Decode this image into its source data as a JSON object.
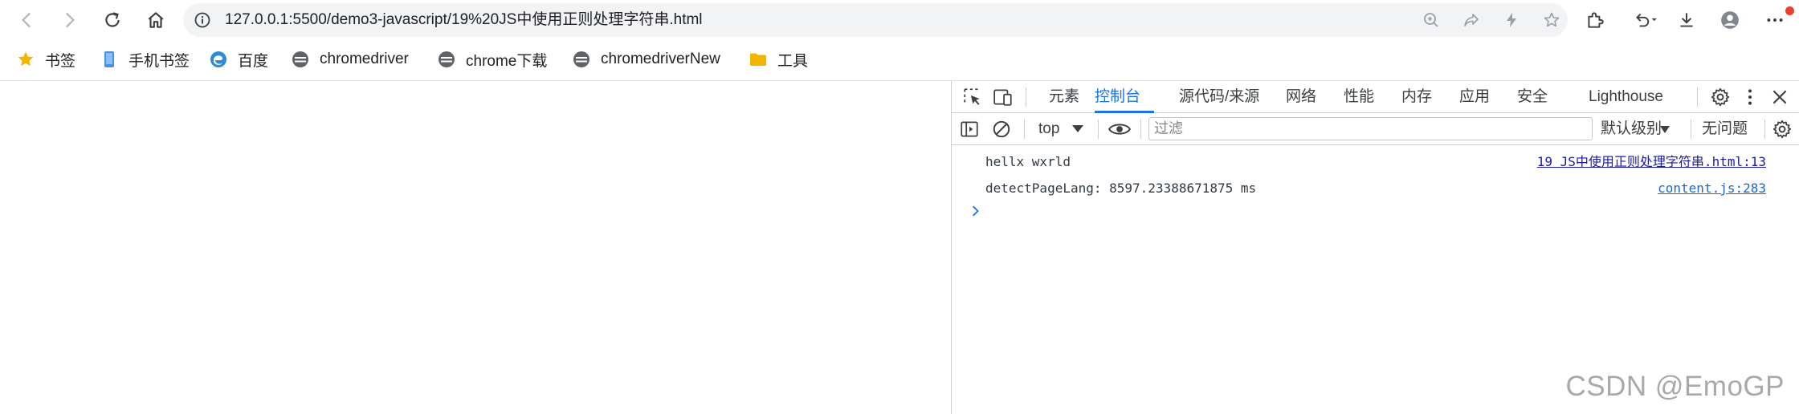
{
  "toolbar": {
    "back_icon": "back-arrow-icon",
    "forward_icon": "forward-arrow-icon",
    "reload_icon": "reload-icon",
    "home_icon": "home-icon",
    "url": "127.0.0.1:5500/demo3-javascript/19%20JS中使用正则处理字符串.html",
    "omnibox_icons": [
      "zoom-icon",
      "share-icon",
      "lightning-icon",
      "star-icon"
    ],
    "right_icons": [
      "extensions-icon",
      "undo-icon",
      "download-icon",
      "profile-icon",
      "more-icon"
    ]
  },
  "bookmarks": [
    {
      "label": "书签",
      "icon": "star-icon",
      "color": "#f5b400"
    },
    {
      "label": "手机书签",
      "icon": "mobile-icon",
      "color": "#4a90e2"
    },
    {
      "label": "百度",
      "icon": "edge-icon",
      "color": "#2b8bd6"
    },
    {
      "label": "chromedriver",
      "icon": "globe-icon",
      "color": "#5f6368"
    },
    {
      "label": "chrome下载",
      "icon": "globe-icon",
      "color": "#5f6368"
    },
    {
      "label": "chromedriverNew",
      "icon": "globe-icon",
      "color": "#5f6368"
    },
    {
      "label": "工具",
      "icon": "folder-icon",
      "color": "#f5b400"
    }
  ],
  "devtools": {
    "tabs": [
      "元素",
      "控制台",
      "源代码/来源",
      "网络",
      "性能",
      "内存",
      "应用",
      "安全",
      "Lighthouse"
    ],
    "active_tab": "控制台",
    "accent": "#1a73e8",
    "console_bar": {
      "context": "top",
      "filter_placeholder": "过滤",
      "level": "默认级别",
      "issues": "无问题"
    },
    "logs": [
      {
        "text": "hellx wxrld",
        "source": "19 JS中使用正则处理字符串.html:13"
      },
      {
        "text": "detectPageLang: 8597.23388671875 ms",
        "source": "content.js:283"
      }
    ]
  },
  "watermark": "CSDN @EmoGP"
}
